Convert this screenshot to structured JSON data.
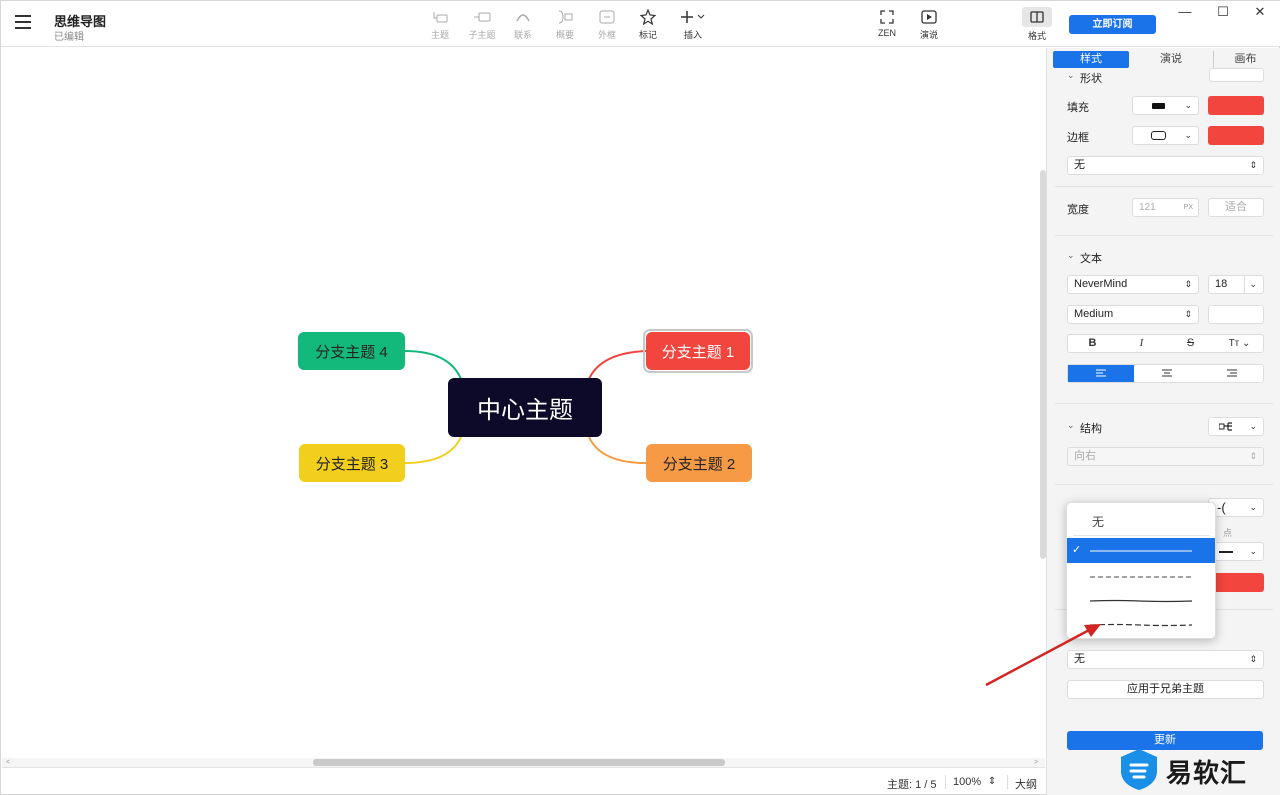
{
  "app": {
    "doc_title": "思维导图",
    "doc_status": "已编辑"
  },
  "toolbar": {
    "topic": "主题",
    "subtopic": "子主题",
    "relation": "联系",
    "summary": "概要",
    "boundary": "外框",
    "marker": "标记",
    "insert": "插入",
    "zen": "ZEN",
    "present": "演说",
    "format": "格式",
    "subscribe": "立即订阅"
  },
  "window_controls": {
    "minimize": "—",
    "maximize": "☐",
    "close": "✕"
  },
  "mindmap": {
    "central": "中心主题",
    "branches": [
      "分支主题 1",
      "分支主题 2",
      "分支主题 3",
      "分支主题 4"
    ],
    "colors": {
      "central": "#0d0a29",
      "b1": "#f2453d",
      "b2": "#f79a45",
      "b3": "#f2ce1d",
      "b4": "#13b97a"
    }
  },
  "statusbar": {
    "topic_count": "主题: 1 / 5",
    "zoom": "100%",
    "outline": "大纲"
  },
  "panel": {
    "tabs": [
      "样式",
      "演说",
      "画布"
    ],
    "shape_label": "形状",
    "fill_label": "填充",
    "border_label": "边框",
    "border_style_value": "无",
    "width_label": "宽度",
    "width_value": "121",
    "width_unit": "PX",
    "fit_button": "适合",
    "text_section": "文本",
    "font_family": "NeverMind",
    "font_size": "18",
    "font_weight": "Medium",
    "bold": "B",
    "italic": "I",
    "strike": "S",
    "case": "Tт",
    "structure_section": "结构",
    "direction": "向右",
    "hidden_label": "点",
    "line_none": "无",
    "apply_siblings": "应用于兄弟主题",
    "update_button": "更新"
  },
  "dropdown": {
    "none_option": "无",
    "options": [
      "无",
      "实线",
      "虚线",
      "手绘实线",
      "手绘虚线"
    ],
    "selected_index": 1
  },
  "watermark": {
    "text": "易软汇"
  }
}
